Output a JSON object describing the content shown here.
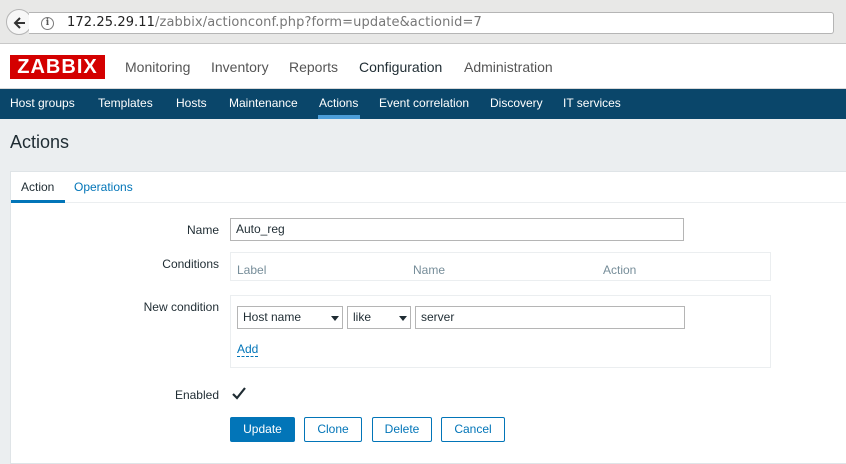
{
  "browser": {
    "url_host": "172.25.29.11",
    "url_path": "/zabbix/actionconf.php?form=update&actionid=7",
    "info_glyph": "i"
  },
  "logo": {
    "text": "ZABBIX",
    "color": "#d40000"
  },
  "topnav": {
    "items": [
      {
        "label": "Monitoring"
      },
      {
        "label": "Inventory"
      },
      {
        "label": "Reports"
      },
      {
        "label": "Configuration",
        "active": true
      },
      {
        "label": "Administration"
      }
    ]
  },
  "subnav": {
    "items": [
      {
        "label": "Host groups"
      },
      {
        "label": "Templates"
      },
      {
        "label": "Hosts"
      },
      {
        "label": "Maintenance"
      },
      {
        "label": "Actions",
        "active": true
      },
      {
        "label": "Event correlation"
      },
      {
        "label": "Discovery"
      },
      {
        "label": "IT services"
      }
    ],
    "bg_color": "#0a466a"
  },
  "page": {
    "title": "Actions"
  },
  "tabs": [
    {
      "label": "Action",
      "active": true
    },
    {
      "label": "Operations"
    }
  ],
  "form": {
    "name_label": "Name",
    "name_value": "Auto_reg",
    "conditions_label": "Conditions",
    "conditions_columns": [
      "Label",
      "Name",
      "Action"
    ],
    "new_condition_label": "New condition",
    "condition_type": "Host name",
    "condition_operator": "like",
    "condition_value": "server",
    "add_link": "Add",
    "enabled_label": "Enabled",
    "enabled": true
  },
  "buttons": {
    "update": "Update",
    "clone": "Clone",
    "delete": "Delete",
    "cancel": "Cancel"
  },
  "colors": {
    "accent": "#0275b8"
  }
}
